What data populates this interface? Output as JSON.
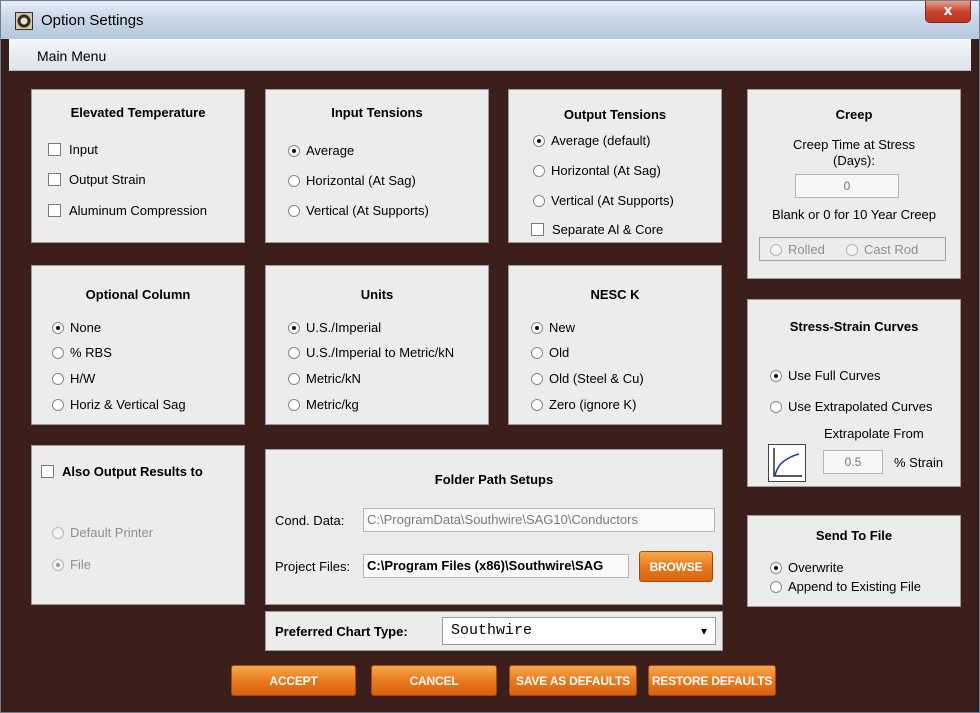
{
  "window": {
    "title": "Option Settings",
    "close_label": "x",
    "menu": "Main Menu"
  },
  "elevated_temperature": {
    "title": "Elevated Temperature",
    "items": [
      "Input",
      "Output Strain",
      "Aluminum Compression"
    ]
  },
  "input_tensions": {
    "title": "Input Tensions",
    "items": [
      "Average",
      "Horizontal (At Sag)",
      "Vertical (At Supports)"
    ],
    "selected": "Average"
  },
  "output_tensions": {
    "title": "Output Tensions",
    "items": [
      "Average (default)",
      "Horizontal (At Sag)",
      "Vertical (At Supports)"
    ],
    "selected": "Average (default)",
    "checkbox": "Separate Al & Core"
  },
  "creep": {
    "title": "Creep",
    "label": "Creep Time at Stress (Days):",
    "value": "0",
    "note": "Blank or 0  for 10 Year Creep",
    "rolled": "Rolled",
    "cast_rod": "Cast Rod"
  },
  "optional_column": {
    "title": "Optional Column",
    "items": [
      "None",
      "% RBS",
      "H/W",
      "Horiz & Vertical Sag"
    ],
    "selected": "None"
  },
  "units": {
    "title": "Units",
    "items": [
      "U.S./Imperial",
      "U.S./Imperial to Metric/kN",
      "Metric/kN",
      "Metric/kg"
    ],
    "selected": "U.S./Imperial"
  },
  "nesc_k": {
    "title": "NESC K",
    "items": [
      "New",
      "Old",
      "Old (Steel & Cu)",
      "Zero (ignore K)"
    ],
    "selected": "New"
  },
  "stress_strain": {
    "title": "Stress-Strain Curves",
    "items": [
      "Use Full Curves",
      "Use Extrapolated Curves"
    ],
    "selected": "Use Full Curves",
    "extrapolate_label": "Extrapolate From",
    "extrapolate_value": "0.5",
    "strain_unit": "% Strain"
  },
  "also_output": {
    "title": "Also Output Results to",
    "items": [
      "Default Printer",
      "File"
    ],
    "selected": "File"
  },
  "folder_paths": {
    "title": "Folder Path Setups",
    "cond_label": "Cond. Data:",
    "cond_value": "C:\\ProgramData\\Southwire\\SAG10\\Conductors",
    "project_label": "Project Files:",
    "project_value": "C:\\Program Files (x86)\\Southwire\\SAG",
    "browse": "BROWSE"
  },
  "send_to_file": {
    "title": "Send To File",
    "items": [
      "Overwrite",
      "Append to Existing File"
    ],
    "selected": "Overwrite"
  },
  "chart_type": {
    "label": "Preferred Chart Type:",
    "value": "Southwire",
    "arrow": "▾"
  },
  "buttons": {
    "accept": "ACCEPT",
    "cancel": "CANCEL",
    "save_defaults": "SAVE AS DEFAULTS",
    "restore_defaults": "RESTORE DEFAULTS"
  },
  "colors": {
    "background": "#3c1f1b",
    "panel": "#ececec",
    "button": "#e7761c"
  }
}
